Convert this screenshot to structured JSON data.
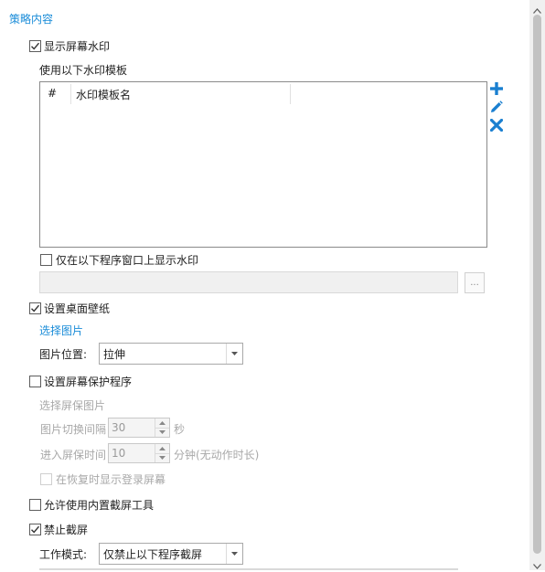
{
  "section_title": "策略内容",
  "watermark": {
    "show_label": "显示屏幕水印",
    "show_checked": true,
    "template_label": "使用以下水印模板",
    "table_columns": [
      "#",
      "水印模板名"
    ],
    "table_rows": [],
    "toolbar_icons": [
      "plus-icon",
      "edit-pencil-icon",
      "delete-x-icon"
    ],
    "only_window_label": "仅在以下程序窗口上显示水印",
    "only_window_checked": false,
    "program_path_value": "",
    "browse_label": "..."
  },
  "wallpaper": {
    "label": "设置桌面壁纸",
    "checked": true,
    "choose_picture_link": "选择图片",
    "position_label": "图片位置:",
    "position_value": "拉伸"
  },
  "screensaver": {
    "label": "设置屏幕保护程序",
    "checked": false,
    "choose_label": "选择屏保图片",
    "interval_label": "图片切换间隔",
    "interval_value": "30",
    "interval_unit": "秒",
    "idle_label": "进入屏保时间",
    "idle_value": "10",
    "idle_unit": "分钟(无动作时长)",
    "resume_label": "在恢复时显示登录屏幕",
    "resume_checked": false
  },
  "builtin_screenshot": {
    "label": "允许使用内置截屏工具",
    "checked": false
  },
  "block_screenshot": {
    "label": "禁止截屏",
    "checked": true,
    "mode_label": "工作模式:",
    "mode_value": "仅禁止以下程序截屏"
  },
  "colors": {
    "accent": "#1a8cd8",
    "disabled_text": "#a8a8a8"
  }
}
